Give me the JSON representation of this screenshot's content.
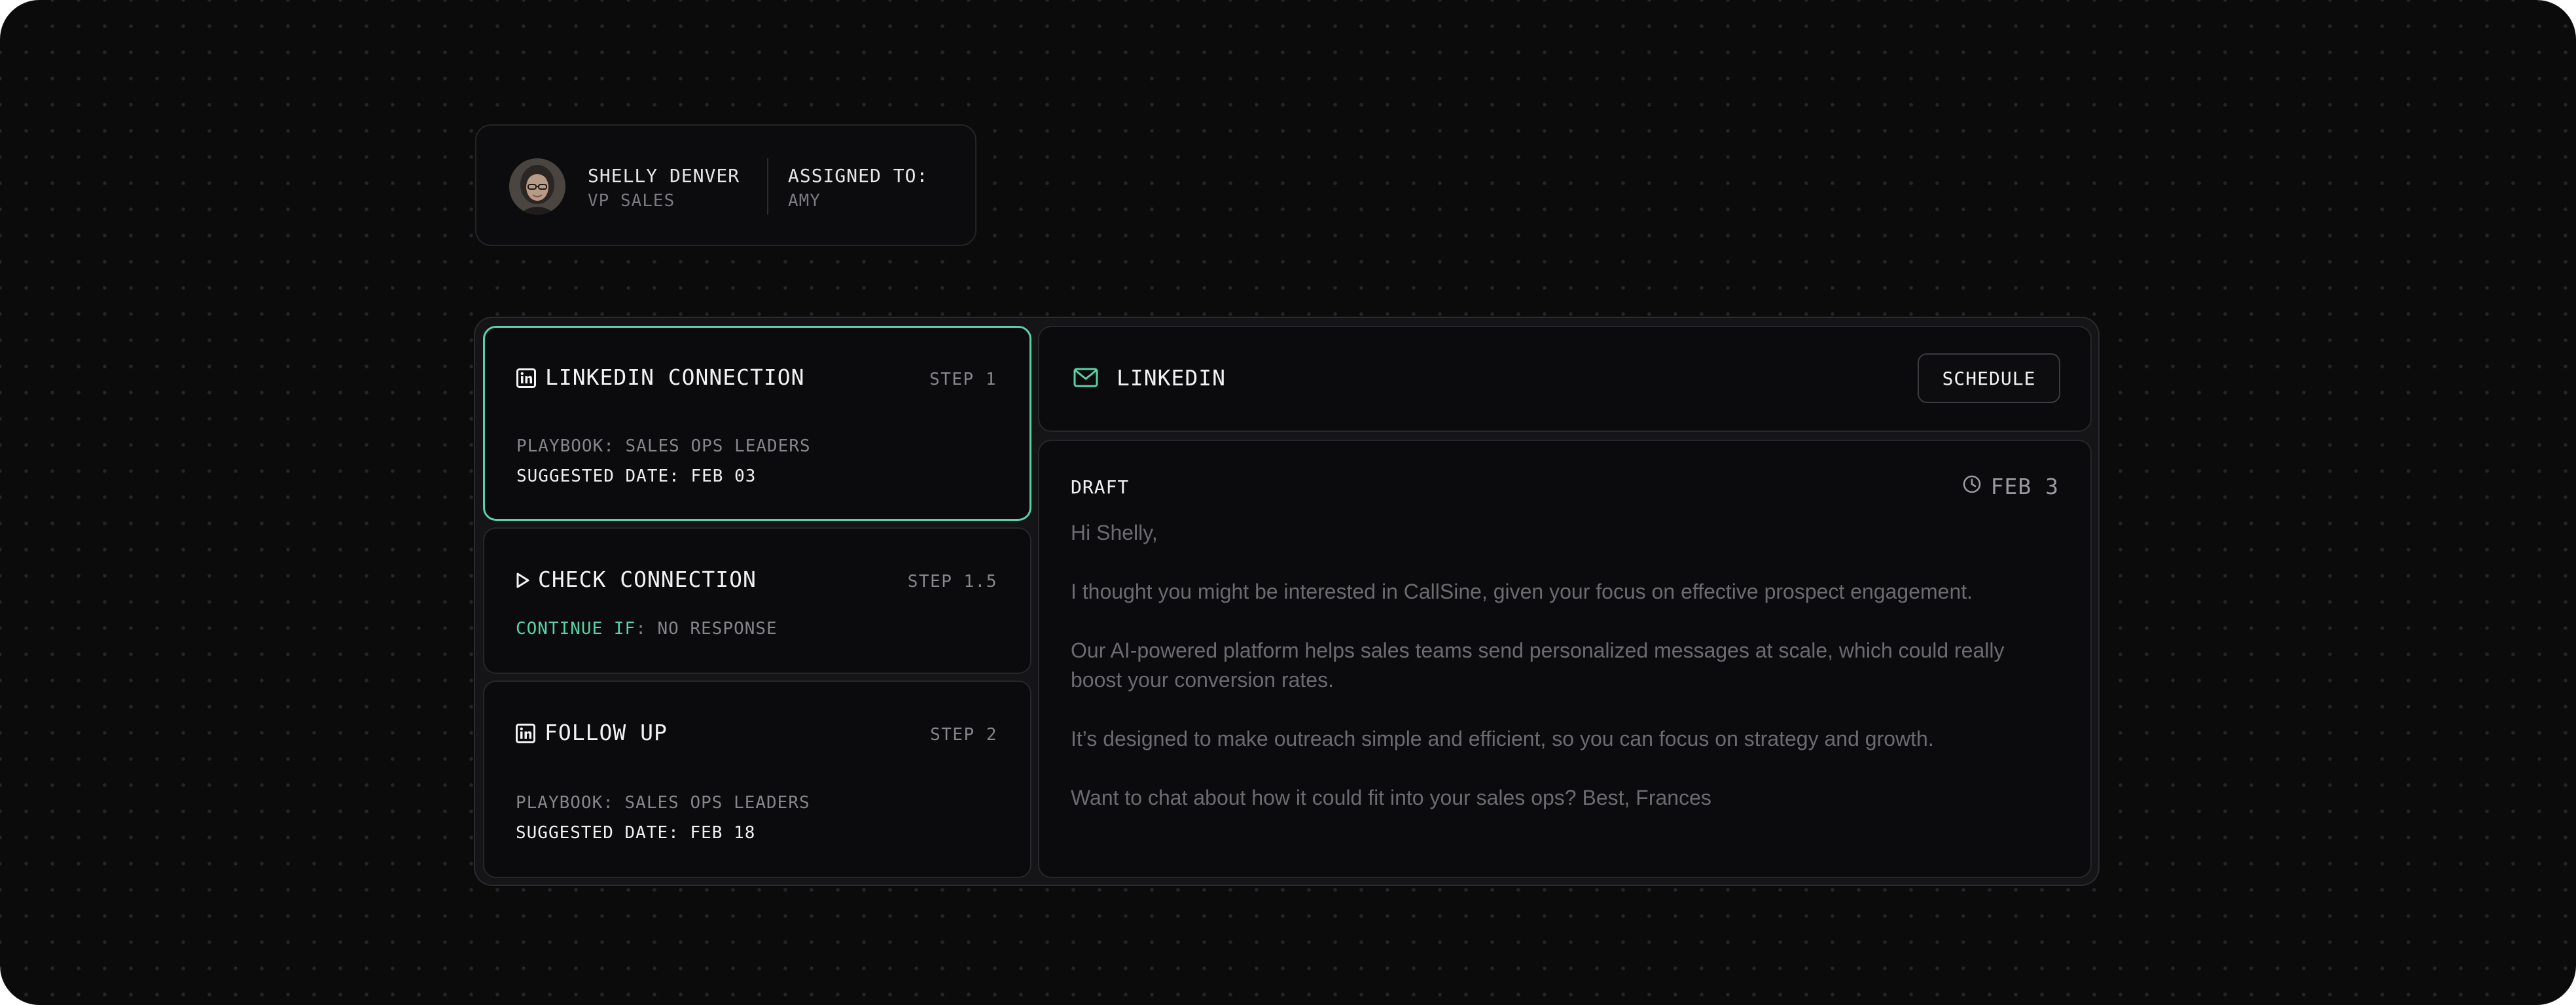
{
  "contact": {
    "name": "SHELLY DENVER",
    "role": "VP SALES",
    "assigned_label": "ASSIGNED TO:",
    "assigned_value": "AMY"
  },
  "steps": [
    {
      "icon": "linkedin-icon",
      "title": "LINKEDIN CONNECTION",
      "step_label": "STEP 1",
      "playbook": "PLAYBOOK: SALES OPS LEADERS",
      "suggested_date": "SUGGESTED DATE: FEB 03",
      "active": true
    },
    {
      "icon": "play-icon",
      "title": "CHECK CONNECTION",
      "step_label": "STEP 1.5",
      "continue_label": "CONTINUE IF",
      "continue_value": ": NO RESPONSE"
    },
    {
      "icon": "linkedin-icon",
      "title": "FOLLOW UP",
      "step_label": "STEP 2",
      "playbook": "PLAYBOOK: SALES OPS LEADERS",
      "suggested_date": "SUGGESTED DATE: FEB 18"
    }
  ],
  "channel": {
    "icon": "mail-icon",
    "title": "LINKEDIN",
    "schedule_label": "SCHEDULE"
  },
  "draft": {
    "label": "DRAFT",
    "date": "FEB 3",
    "paragraphs": [
      "Hi Shelly,",
      "I thought you might be interested in CallSine, given your focus on effective prospect engagement.",
      "Our AI-powered platform helps sales teams send personalized messages at scale, which could really boost your conversion rates.",
      "It’s designed to make outreach simple and efficient, so you can focus on strategy and growth.",
      "Want to chat about how it could fit into your sales ops? Best, Frances"
    ]
  },
  "colors": {
    "background": "#0b0b0c",
    "accent": "#5ad2a6",
    "card": "#0b0b0d",
    "panel": "#151517"
  }
}
